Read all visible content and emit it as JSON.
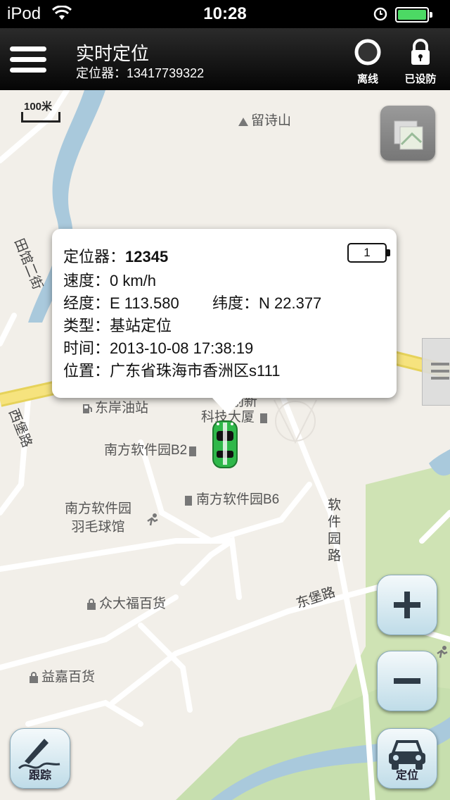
{
  "status_bar": {
    "carrier": "iPod",
    "time": "10:28"
  },
  "header": {
    "title": "实时定位",
    "subtitle": "定位器：13417739322",
    "offline_label": "离线",
    "armed_label": "已设防"
  },
  "map": {
    "scale_label": "100米",
    "labels": {
      "liushi_mountain": "留诗山",
      "tianguan_street": "田馆二街",
      "xibao_road": "西堡路",
      "dongan_gas": "东岸油站",
      "building_a": "南方软件园B2",
      "building_b": "南方软件园B6",
      "badminton_line1": "南方软件园",
      "badminton_line2": "羽毛球馆",
      "tech_tower_line1": "创新",
      "tech_tower_line2": "科技大厦",
      "software_road": "软件园路",
      "dongbao_road": "东堡路",
      "zhongdafu": "众大福百货",
      "yijia": "益嘉百货"
    }
  },
  "popup": {
    "device_label": "定位器：",
    "device_id": "12345",
    "battery_level": "1",
    "speed": "速度：0 km/h",
    "longitude": "经度：E 113.580",
    "latitude": "纬度：N 22.377",
    "type": "类型：基站定位",
    "time": "时间：2013-10-08 17:38:19",
    "location": "位置：广东省珠海市香洲区s111"
  },
  "buttons": {
    "track_label": "跟踪",
    "locate_label": "定位"
  },
  "colors": {
    "car": "#2fb84a",
    "river": "#a9c9dc",
    "park": "#cfe3b4",
    "main_road": "#f4e07a"
  }
}
